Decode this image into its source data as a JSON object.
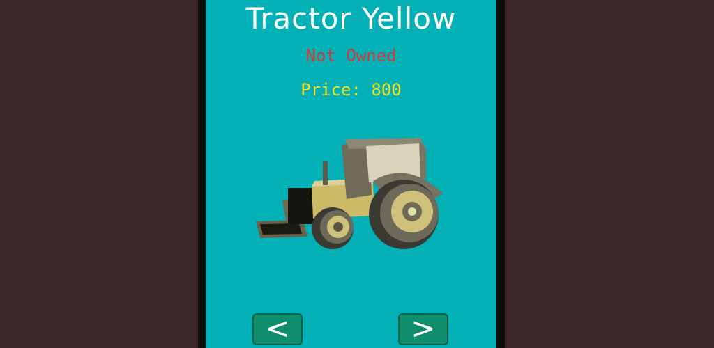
{
  "shop": {
    "vehicle_name": "Tractor Yellow",
    "ownership_status": "Not Owned",
    "price_label": "Price: 800"
  },
  "navigation": {
    "prev_label": "<",
    "next_label": ">"
  },
  "colors": {
    "background": "#3a2828",
    "panel": "#02b0b5",
    "title": "#ffffff",
    "status": "#d93636",
    "price": "#f2e01e",
    "button": "#0f8e6b"
  },
  "icons": {
    "vehicle": "tractor-yellow-model"
  }
}
